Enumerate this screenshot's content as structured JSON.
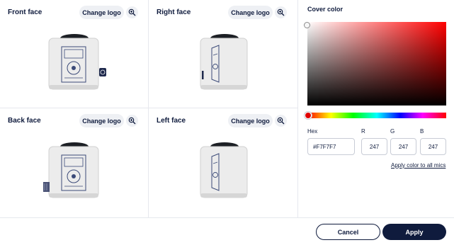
{
  "faces": [
    {
      "title": "Front face",
      "change_logo_label": "Change logo",
      "view": "front"
    },
    {
      "title": "Right face",
      "change_logo_label": "Change logo",
      "view": "right"
    },
    {
      "title": "Back face",
      "change_logo_label": "Change logo",
      "view": "back"
    },
    {
      "title": "Left face",
      "change_logo_label": "Change logo",
      "view": "left"
    }
  ],
  "color_picker": {
    "title": "Cover color",
    "hex_label": "Hex",
    "r_label": "R",
    "g_label": "G",
    "b_label": "B",
    "hex_value": "#F7F7F7",
    "r_value": "247",
    "g_value": "247",
    "b_value": "247",
    "hue_color": "#ff0000",
    "apply_all_label": "Apply color to all mics"
  },
  "footer": {
    "cancel_label": "Cancel",
    "apply_label": "Apply"
  },
  "colors": {
    "accent": "#0f1b3d",
    "button_bg": "#eef0f4",
    "cover": "#F7F7F7"
  }
}
